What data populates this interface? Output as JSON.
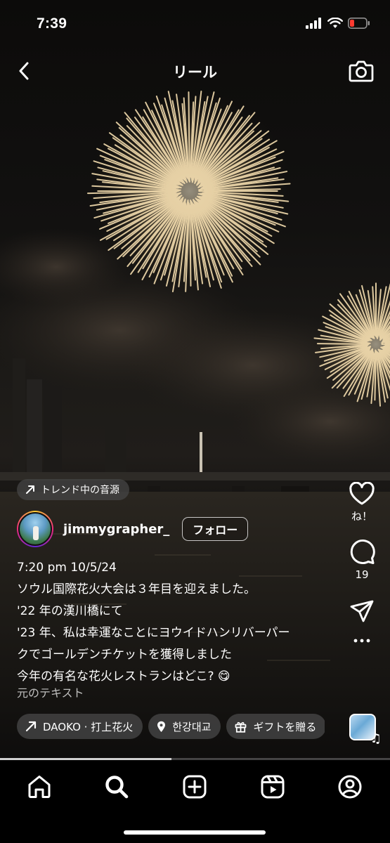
{
  "status_bar": {
    "time": "7:39",
    "icons": [
      "signal-icon",
      "wifi-icon",
      "battery-low-icon"
    ],
    "battery_color": "#ff3b30"
  },
  "header": {
    "title": "リール",
    "back_icon": "chevron-left-icon",
    "camera_icon": "camera-icon"
  },
  "trend_pill": {
    "icon": "trend-arrow-icon",
    "label": "トレンド中の音源"
  },
  "author": {
    "username": "jimmygrapher_",
    "follow_label": "フォロー"
  },
  "caption": {
    "lines": [
      "7:20 pm 10/5/24",
      "ソウル国際花火大会は３年目を迎えました。",
      "'22 年の漢川橋にて",
      "'23 年、私は幸運なことにヨウイドハンリバーパー",
      "クでゴールデンチケットを獲得しました",
      "今年の有名な花火レストランはどこ? 😋"
    ],
    "original_text_label": "元のテキスト"
  },
  "chips": [
    {
      "icon": "trend-arrow-icon",
      "label": "DAOKO · 打上花火"
    },
    {
      "icon": "location-pin-icon",
      "label": "한강대교"
    },
    {
      "icon": "gift-icon",
      "label": "ギフトを贈る"
    }
  ],
  "actions": {
    "like_label": "ね！",
    "comment_count": "19",
    "like_icon": "heart-icon",
    "comment_icon": "comment-icon",
    "share_icon": "send-icon",
    "more_icon": "more-icon",
    "audio_icon": "music-note-icon"
  },
  "video_progress": 0.44,
  "tab_bar": {
    "tabs": [
      "home-icon",
      "search-icon",
      "create-icon",
      "reels-icon",
      "profile-icon"
    ],
    "active": "search-icon"
  },
  "colors": {
    "background": "#000000",
    "firework": "#f3dcae",
    "avatar_ring_start": "#f9ce34",
    "avatar_ring_mid": "#ee2a7b"
  }
}
